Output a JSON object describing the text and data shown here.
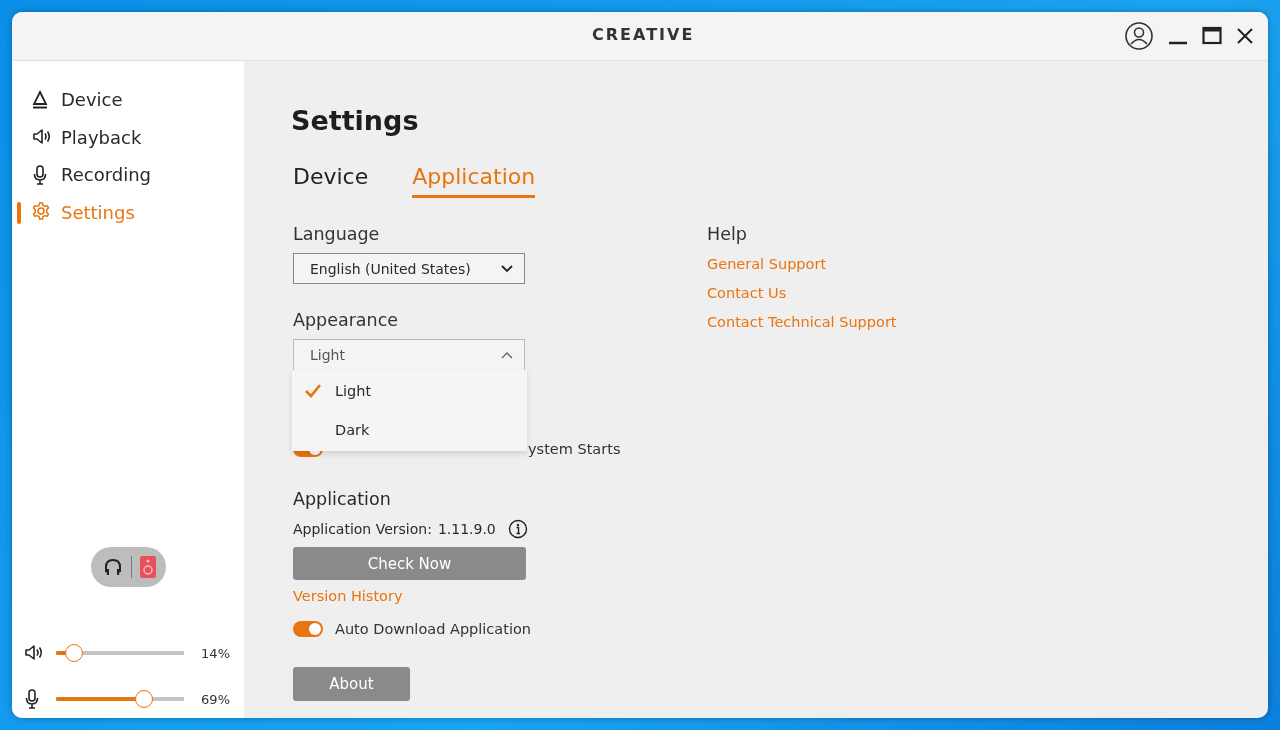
{
  "window": {
    "logo": "CREATIVE"
  },
  "sidebar": {
    "items": [
      {
        "label": "Device",
        "kind": "device",
        "selected": false
      },
      {
        "label": "Playback",
        "kind": "speaker",
        "selected": false
      },
      {
        "label": "Recording",
        "kind": "mic",
        "selected": false
      },
      {
        "label": "Settings",
        "kind": "gear",
        "selected": true
      }
    ]
  },
  "outputs": [
    {
      "kind": "headphones",
      "selected": false
    },
    {
      "kind": "speaker",
      "selected": true
    }
  ],
  "volume": [
    {
      "kind": "speaker",
      "level": 0.14,
      "reading": "14%"
    },
    {
      "kind": "mic",
      "level": 0.69,
      "reading": "69%"
    }
  ],
  "title": "Settings",
  "tabs": [
    {
      "label": "Device",
      "selected": false
    },
    {
      "label": "Application",
      "selected": true
    }
  ],
  "language": {
    "label": "Language",
    "value": "English (United States)",
    "expanded": false
  },
  "appearance": {
    "label": "Appearance",
    "value": "Light",
    "expanded": true,
    "options": [
      {
        "label": "Light",
        "selected": true
      },
      {
        "label": "Dark",
        "selected": false
      }
    ]
  },
  "startup": {
    "label": "ystem Starts",
    "on": true
  },
  "application": {
    "heading": "Application",
    "version_label": "Application Version:",
    "version": "1.11.9.0",
    "check_button": "Check Now",
    "history_link": "Version History",
    "auto_download": {
      "label": "Auto Download Application",
      "on": true
    },
    "about_button": "About"
  },
  "help": {
    "heading": "Help",
    "links": [
      "General Support",
      "Contact Us",
      "Contact Technical Support"
    ]
  }
}
